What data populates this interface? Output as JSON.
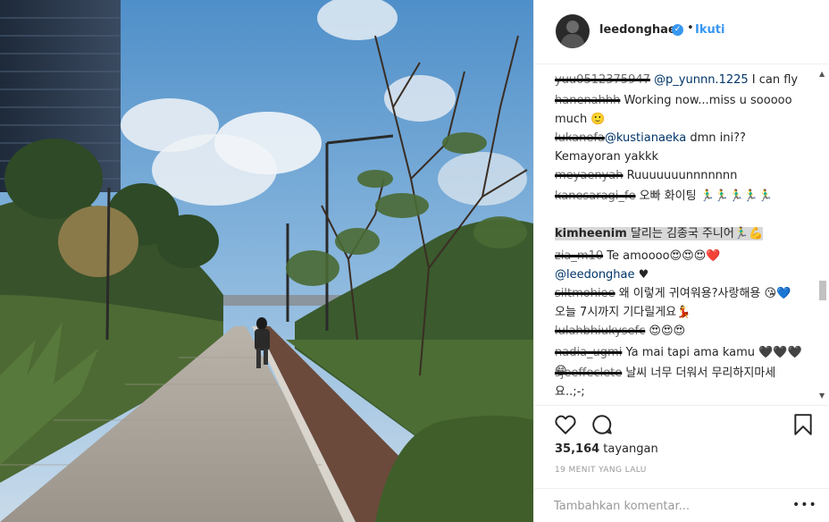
{
  "post": {
    "username": "leedonghae",
    "follow_label": "Ikuti",
    "dot": "•"
  },
  "comments": [
    {
      "user": "yuu0512375947",
      "mention": "@p_yunnn.1225",
      "text": " I can fly",
      "user_struck": true
    },
    {
      "user": "hanenahhh",
      "text": " Working now...miss u sooooo much 🙂",
      "user_struck": true
    },
    {
      "user": "lukanefa",
      "mention": "@kustianaeka",
      "text": " dmn ini?? Kemayoran yakkk",
      "user_struck": true
    },
    {
      "user": "meyaenyah",
      "text": " Ruuuuuuunnnnnnn",
      "user_struck": true
    },
    {
      "user": "kanesaragi_fe",
      "text": " 오빠 화이팅 🏃‍♂️🏃‍♂️🏃‍♂️🏃‍♂️🏃‍♂️",
      "user_struck": true
    },
    {
      "user": "kimheenim",
      "text": " 달리는 김종국 주니어🏃‍♂️💪",
      "user_struck": false
    },
    {
      "user": "zia_m10",
      "text": " Te amoooo😍😍😍❤️ ",
      "mention": "@leedonghae",
      "text2": " ♥",
      "user_struck": true
    },
    {
      "user": "siltmohiee",
      "text": " 왜 이렇게 귀여워용?사랑해용 😘💙 오늘 7시까지 기다릴게요💃",
      "user_struck": true
    },
    {
      "user": "lulahbhiukysefc",
      "text": " 😍😍😍",
      "user_struck": true
    },
    {
      "user": "nadia_ugmi",
      "text": " Ya mai tapi ama kamu 🖤🖤🖤😁",
      "user_struck": true
    },
    {
      "user": "sjeeffeclete",
      "text": " 날씨 너무 더워서 무리하지마세요..;-;",
      "user_struck": true
    }
  ],
  "stats": {
    "views_count": "35,164",
    "views_label": " tayangan",
    "timestamp": "19 MENIT YANG LALU"
  },
  "add_comment": {
    "placeholder": "Tambahkan komentar..."
  },
  "icons": {
    "like": "heart-outline-icon",
    "comment": "speech-bubble-icon",
    "save": "bookmark-icon",
    "verified": "verified-badge-icon",
    "more": "more-options-icon"
  },
  "colors": {
    "link": "#3897f0",
    "mention": "#003569",
    "muted": "#999999",
    "highlight": "#d8d8d8"
  }
}
